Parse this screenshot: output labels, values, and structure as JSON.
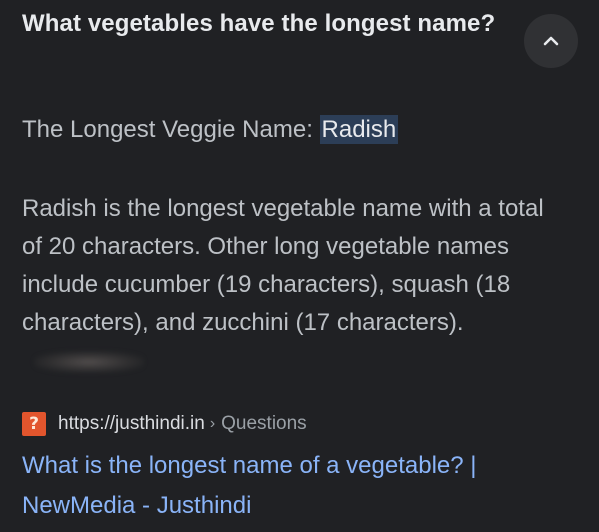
{
  "question": {
    "title": "What vegetables have the longest name?"
  },
  "answer": {
    "headline_lead": "The Longest Veggie Name: ",
    "headline_highlight": "Radish",
    "body": "Radish is the longest vegetable name with a total of 20 characters. Other long vegetable names include cucumber (19 characters), squash (18 characters), and zucchini (17 characters)."
  },
  "source": {
    "favicon_glyph": "?",
    "favicon_color": "#e2552d",
    "url": "https://justhindi.in",
    "separator": "›",
    "path": "Questions"
  },
  "result": {
    "title": "What is the longest name of a vegetable? | NewMedia - Justhindi"
  },
  "icons": {
    "collapse": "chevron-up-icon"
  },
  "colors": {
    "background": "#202124",
    "link": "#8ab4f8",
    "highlight": "#2c3e57"
  }
}
